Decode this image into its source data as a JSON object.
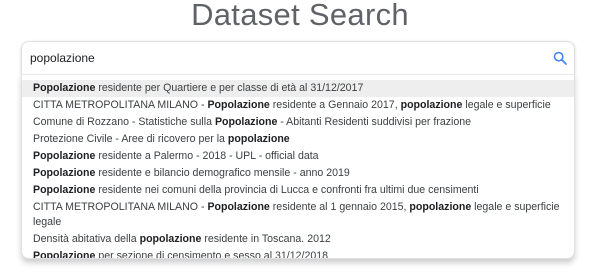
{
  "title": "Dataset Search",
  "search": {
    "value": "popolazione",
    "icon": "search-icon",
    "icon_color": "#4285f4"
  },
  "colors": {
    "title": "#5f6368",
    "highlight_bg": "#eeeeee",
    "text": "#3c4043"
  },
  "suggestions": [
    {
      "highlighted": true,
      "parts": [
        {
          "text": "Popolazione",
          "bold": true
        },
        {
          "text": " residente per Quartiere e per classe di età al 31/12/2017",
          "bold": false
        }
      ]
    },
    {
      "highlighted": false,
      "parts": [
        {
          "text": "CITTA METROPOLITANA MILANO - ",
          "bold": false
        },
        {
          "text": "Popolazione",
          "bold": true
        },
        {
          "text": " residente a Gennaio 2017, ",
          "bold": false
        },
        {
          "text": "popolazione",
          "bold": true
        },
        {
          "text": " legale e superficie",
          "bold": false
        }
      ]
    },
    {
      "highlighted": false,
      "parts": [
        {
          "text": "Comune di Rozzano - Statistiche sulla ",
          "bold": false
        },
        {
          "text": "Popolazione",
          "bold": true
        },
        {
          "text": " - Abitanti Residenti suddivisi per frazione",
          "bold": false
        }
      ]
    },
    {
      "highlighted": false,
      "parts": [
        {
          "text": "Protezione Civile - Aree di ricovero per la ",
          "bold": false
        },
        {
          "text": "popolazione",
          "bold": true
        }
      ]
    },
    {
      "highlighted": false,
      "parts": [
        {
          "text": "Popolazione",
          "bold": true
        },
        {
          "text": " residente a Palermo - 2018 - UPL - official data",
          "bold": false
        }
      ]
    },
    {
      "highlighted": false,
      "parts": [
        {
          "text": "Popolazione",
          "bold": true
        },
        {
          "text": " residente e bilancio demografico mensile - anno 2019",
          "bold": false
        }
      ]
    },
    {
      "highlighted": false,
      "parts": [
        {
          "text": "Popolazione",
          "bold": true
        },
        {
          "text": " residente nei comuni della provincia di Lucca e confronti fra ultimi due censimenti",
          "bold": false
        }
      ]
    },
    {
      "highlighted": false,
      "parts": [
        {
          "text": "CITTA METROPOLITANA MILANO - ",
          "bold": false
        },
        {
          "text": "Popolazione",
          "bold": true
        },
        {
          "text": " residente al 1 gennaio 2015, ",
          "bold": false
        },
        {
          "text": "popolazione",
          "bold": true
        },
        {
          "text": " legale e superficie legale",
          "bold": false
        }
      ]
    },
    {
      "highlighted": false,
      "parts": [
        {
          "text": "Densità abitativa della ",
          "bold": false
        },
        {
          "text": "popolazione",
          "bold": true
        },
        {
          "text": " residente in Toscana. 2012",
          "bold": false
        }
      ]
    },
    {
      "highlighted": false,
      "parts": [
        {
          "text": "Popolazione",
          "bold": true
        },
        {
          "text": " per sezione di censimento e sesso al 31/12/2018",
          "bold": false
        }
      ]
    }
  ]
}
